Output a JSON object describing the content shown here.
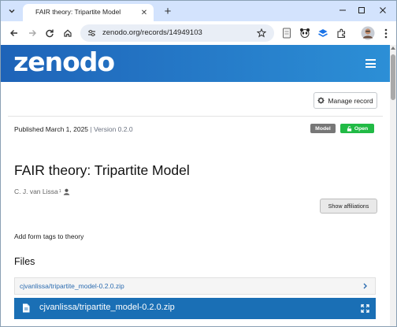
{
  "browser": {
    "tab": {
      "title": "FAIR theory: Tripartite Model"
    },
    "url": "zenodo.org/records/14949103",
    "icons": [
      "tab-search-icon",
      "close-icon",
      "plus-icon",
      "minimize-icon",
      "maximize-icon",
      "back-icon",
      "forward-icon",
      "reload-icon",
      "home-icon",
      "site-info-icon",
      "star-icon",
      "reader-icon",
      "panda-extension-icon",
      "stack-extension-icon",
      "puzzle-icon",
      "profile-avatar",
      "more-vert-icon"
    ]
  },
  "header": {
    "logo": "zenodo",
    "menu_icon": "hamburger-icon",
    "colors": {
      "gradient_start": "#1e63b8",
      "gradient_end": "#2c8fd6"
    }
  },
  "record": {
    "manage_label": "Manage record",
    "published": "Published March 1, 2025",
    "separator": " | ",
    "version": "Version 0.2.0",
    "badges": {
      "type": "Model",
      "access": "Open"
    },
    "badge_colors": {
      "type": "#777777",
      "access": "#21ba45"
    },
    "title": "FAIR theory: Tripartite Model",
    "author": "C. J. van Lissa",
    "author_affiliation_marker": "1",
    "affiliations_button": "Show affiliations",
    "description": "Add form tags to theory"
  },
  "files": {
    "heading": "Files",
    "items": [
      {
        "name": "cjvanlissa/tripartite_model-0.2.0.zip"
      }
    ],
    "preview": {
      "name": "cjvanlissa/tripartite_model-0.2.0.zip"
    },
    "colors": {
      "link": "#2c6cb0",
      "preview_bg": "#1a6fb5"
    }
  }
}
